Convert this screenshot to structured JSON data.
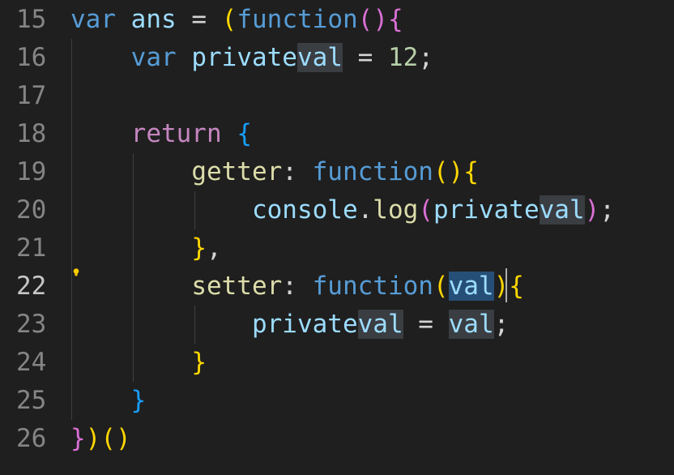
{
  "editor": {
    "language": "javascript",
    "active_line": 22,
    "lines": [
      {
        "number": "15",
        "tokens": [
          {
            "text": "var",
            "kind": "kw"
          },
          {
            "text": " ",
            "kind": "op"
          },
          {
            "text": "ans",
            "kind": "var"
          },
          {
            "text": " = ",
            "kind": "op"
          },
          {
            "text": "(",
            "kind": "p1"
          },
          {
            "text": "function",
            "kind": "kw"
          },
          {
            "text": "()",
            "kind": "p2"
          },
          {
            "text": "{",
            "kind": "p2"
          }
        ]
      },
      {
        "number": "16",
        "tokens": [
          {
            "text": "    ",
            "kind": "op"
          },
          {
            "text": "var",
            "kind": "kw"
          },
          {
            "text": " ",
            "kind": "op"
          },
          {
            "text": "private",
            "kind": "var"
          },
          {
            "text": "val",
            "kind": "var",
            "mark": "hl"
          },
          {
            "text": " = ",
            "kind": "op"
          },
          {
            "text": "12",
            "kind": "num"
          },
          {
            "text": ";",
            "kind": "op"
          }
        ]
      },
      {
        "number": "17",
        "tokens": []
      },
      {
        "number": "18",
        "tokens": [
          {
            "text": "    ",
            "kind": "op"
          },
          {
            "text": "return",
            "kind": "ctl"
          },
          {
            "text": " ",
            "kind": "op"
          },
          {
            "text": "{",
            "kind": "p3"
          }
        ]
      },
      {
        "number": "19",
        "tokens": [
          {
            "text": "        ",
            "kind": "op"
          },
          {
            "text": "getter",
            "kind": "fn"
          },
          {
            "text": ": ",
            "kind": "op"
          },
          {
            "text": "function",
            "kind": "kw"
          },
          {
            "text": "()",
            "kind": "p1"
          },
          {
            "text": "{",
            "kind": "p1"
          }
        ]
      },
      {
        "number": "20",
        "tokens": [
          {
            "text": "            ",
            "kind": "op"
          },
          {
            "text": "console",
            "kind": "var"
          },
          {
            "text": ".",
            "kind": "op"
          },
          {
            "text": "log",
            "kind": "fn"
          },
          {
            "text": "(",
            "kind": "p2"
          },
          {
            "text": "private",
            "kind": "var"
          },
          {
            "text": "val",
            "kind": "var",
            "mark": "hl"
          },
          {
            "text": ")",
            "kind": "p2"
          },
          {
            "text": ";",
            "kind": "op"
          }
        ]
      },
      {
        "number": "21",
        "tokens": [
          {
            "text": "        ",
            "kind": "op"
          },
          {
            "text": "}",
            "kind": "p1"
          },
          {
            "text": ",",
            "kind": "op"
          }
        ]
      },
      {
        "number": "22",
        "tokens": [
          {
            "text": "        ",
            "kind": "op"
          },
          {
            "text": "setter",
            "kind": "fn"
          },
          {
            "text": ": ",
            "kind": "op"
          },
          {
            "text": "function",
            "kind": "kw"
          },
          {
            "text": "(",
            "kind": "p1"
          },
          {
            "text": "val",
            "kind": "var",
            "mark": "sel"
          },
          {
            "text": ")",
            "kind": "p1"
          },
          {
            "text": "{",
            "kind": "p1"
          }
        ]
      },
      {
        "number": "23",
        "tokens": [
          {
            "text": "            ",
            "kind": "op"
          },
          {
            "text": "private",
            "kind": "var"
          },
          {
            "text": "val",
            "kind": "var",
            "mark": "hl"
          },
          {
            "text": " = ",
            "kind": "op"
          },
          {
            "text": "val",
            "kind": "var",
            "mark": "hl"
          },
          {
            "text": ";",
            "kind": "op"
          }
        ]
      },
      {
        "number": "24",
        "tokens": [
          {
            "text": "        ",
            "kind": "op"
          },
          {
            "text": "}",
            "kind": "p1"
          }
        ]
      },
      {
        "number": "25",
        "tokens": [
          {
            "text": "    ",
            "kind": "op"
          },
          {
            "text": "}",
            "kind": "p3"
          }
        ]
      },
      {
        "number": "26",
        "tokens": [
          {
            "text": "}",
            "kind": "p2"
          },
          {
            "text": ")",
            "kind": "p1"
          },
          {
            "text": "()",
            "kind": "p1"
          }
        ]
      }
    ],
    "icons": {
      "lightbulb": "lightbulb-icon",
      "cursor": "text-cursor-icon"
    },
    "colors": {
      "background": "#1f1f1f",
      "keyword": "#569cd6",
      "control": "#c586c0",
      "variable": "#9cdcfe",
      "number": "#b5cea8",
      "function": "#dcdcaa",
      "bracket_gold": "#ffd700",
      "bracket_orchid": "#da70d6",
      "bracket_blue": "#179fff",
      "selection": "#264f78",
      "word_highlight": "#3a3d41",
      "lightbulb": "#ffcc00"
    }
  }
}
